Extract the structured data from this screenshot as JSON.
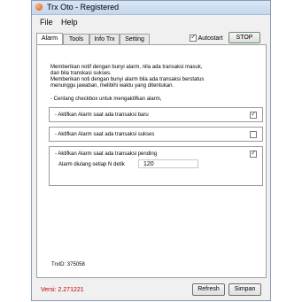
{
  "window": {
    "title": "Trx Oto - Registered"
  },
  "menu": {
    "file": "File",
    "help": "Help"
  },
  "tabs": [
    "Alarm",
    "Tools",
    "Info Trx",
    "Setting"
  ],
  "autostart": {
    "label": "Autostart",
    "checked": true
  },
  "stop_button": "STOP",
  "description": [
    "Memberikan notif dengan bunyi alarm, nila ada transaksi masuk,",
    "dan bila transkasi sukses.",
    "Memberikan noti dengan bunyi alarm bila ada transaksi berstatus",
    "menunggu jawaban, melibihi waktu yang ditentukan."
  ],
  "instruction": "- Centang checkbox untuk mengaktifkan alarm,",
  "options": [
    {
      "label": "- Aktifkan Alarm saat ada transaksi baru",
      "checked": true
    },
    {
      "label": "- Aktifkan Alarm saat ada transaksi sukses",
      "checked": false
    },
    {
      "label": "- Aktifkan Alarm saat ada transaksi pending",
      "checked": true
    }
  ],
  "repeat": {
    "label": "Alarm diulang setiap N detik",
    "value": "120"
  },
  "trx_id": "TrxID: 375058",
  "version": "Versi: 2.271221",
  "buttons": {
    "refresh": "Refresh",
    "simpan": "Simpan"
  }
}
